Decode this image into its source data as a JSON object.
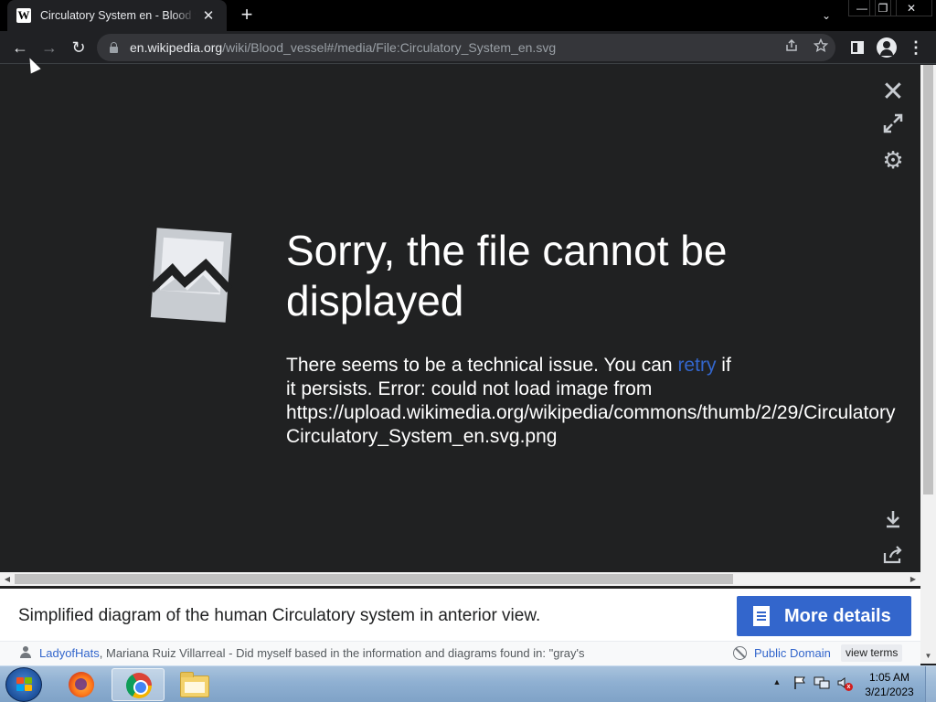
{
  "browser": {
    "tab": {
      "favicon": "W",
      "title": "Circulatory System en - Blood vessel - Wikipedia",
      "close": "✕"
    },
    "new_tab": "+",
    "tab_search": "⌄",
    "window": {
      "minimize": "—",
      "maximize": "❐",
      "close": "✕"
    },
    "nav": {
      "back": "←",
      "forward": "→",
      "reload": "↻"
    },
    "url": {
      "host": "en.wikipedia.org",
      "path": "/wiki/Blood_vessel#/media/File:Circulatory_System_en.svg"
    },
    "menu": "⋮"
  },
  "viewer": {
    "error_title": "Sorry, the file cannot be displayed",
    "msg_before_link": "There seems to be a technical issue. You can ",
    "retry_link": "retry",
    "msg_after_link": " if",
    "msg_line2": "it persists. Error: could not load image from",
    "msg_line3": "https://upload.wikimedia.org/wikipedia/commons/thumb/2/29/Circulatory",
    "msg_line4": "Circulatory_System_en.svg.png",
    "controls": {
      "close": "✕",
      "fullscreen": "⤢",
      "settings": "⚙",
      "download": "⤓",
      "share": "⇪"
    }
  },
  "metadata": {
    "caption": "Simplified diagram of the human Circulatory system in anterior view.",
    "more_details": "More details",
    "author_link": "LadyofHats",
    "author_rest": ", Mariana Ruiz Villarreal - Did myself based in the information and diagrams found in: \"gray's",
    "license": "Public Domain",
    "view_terms": "view terms"
  },
  "taskbar": {
    "apps": [
      "Firefox",
      "Google Chrome",
      "Windows Explorer"
    ],
    "time": "1:05 AM",
    "date": "3/21/2023"
  },
  "colors": {
    "link": "#3366cc",
    "viewer_bg": "#202122",
    "button_bg": "#3366cc"
  }
}
